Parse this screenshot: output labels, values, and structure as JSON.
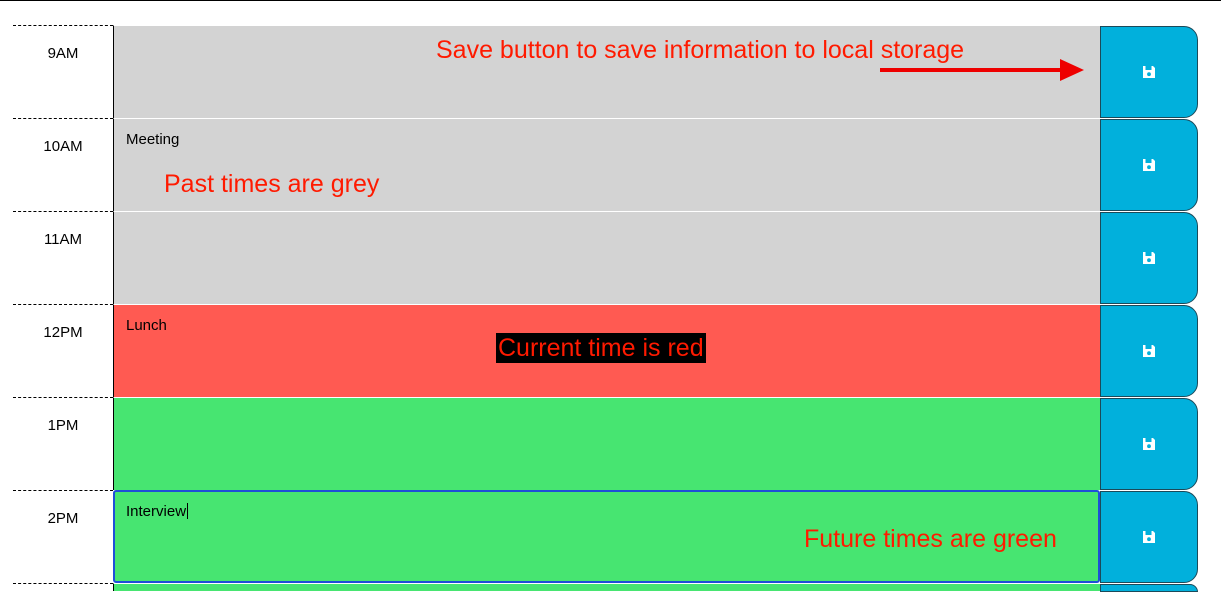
{
  "planner": {
    "rows": [
      {
        "hour": "9AM",
        "text": "",
        "state": "past"
      },
      {
        "hour": "10AM",
        "text": "Meeting",
        "state": "past"
      },
      {
        "hour": "11AM",
        "text": "",
        "state": "past"
      },
      {
        "hour": "12PM",
        "text": "Lunch",
        "state": "present"
      },
      {
        "hour": "1PM",
        "text": "",
        "state": "future"
      },
      {
        "hour": "2PM",
        "text": "Interview",
        "state": "future"
      }
    ],
    "save_icon": "save-icon"
  },
  "annotations": {
    "save": "Save button to save information to local storage",
    "past": "Past times are grey",
    "present": "Current time is red",
    "future": "Future times are green"
  },
  "colors": {
    "past": "#d3d3d3",
    "present": "#ff5a52",
    "future": "#47e571",
    "save_button": "#01b0dc",
    "annotation": "#ff1a00"
  }
}
